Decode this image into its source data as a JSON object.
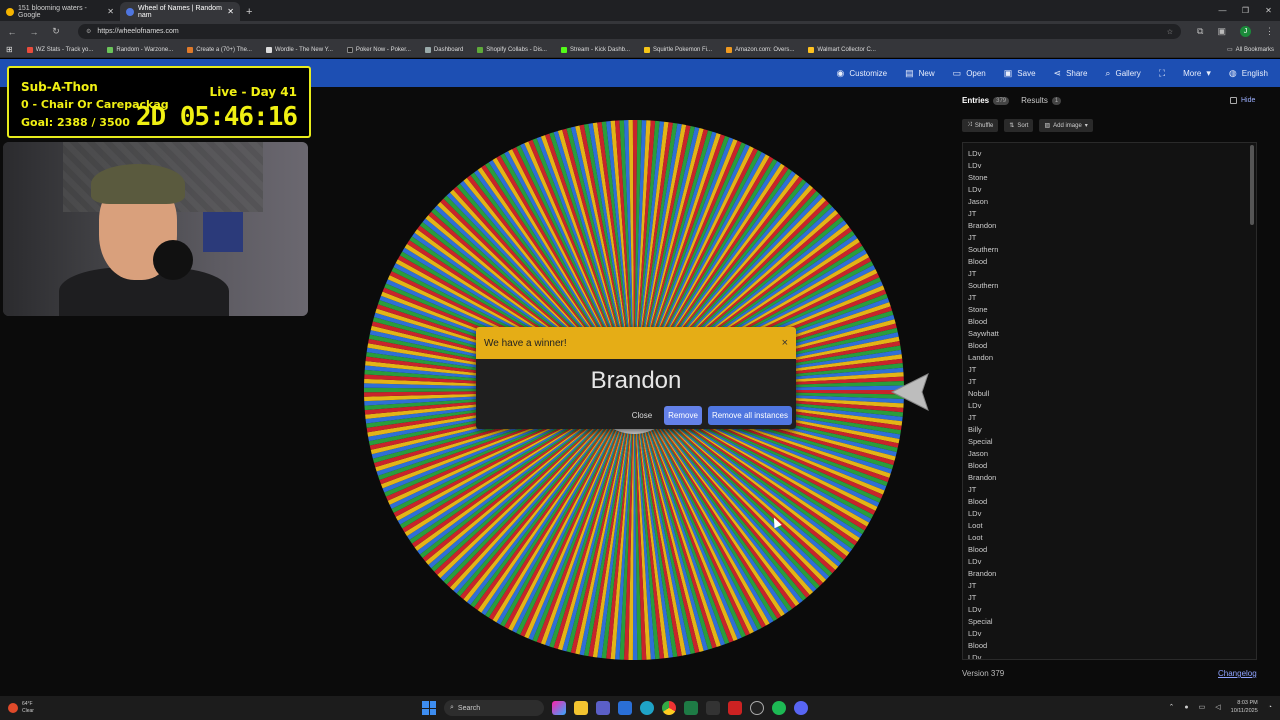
{
  "browser": {
    "tabs": [
      {
        "title": "151 blooming waters - Google",
        "favicon_color": "#f5b400",
        "active": false
      },
      {
        "title": "Wheel of Names | Random nam",
        "favicon_color": "#4f76e0",
        "active": true
      }
    ],
    "new_tab": "+",
    "window_controls": [
      "—",
      "❐",
      "✕"
    ],
    "url": "https://wheelofnames.com",
    "bookmarks": [
      "WZ Stats - Track yo...",
      "Random - Warzone...",
      "Create a (70+) The...",
      "Wordle - The New Y...",
      "Poker Now - Poker...",
      "Dashboard",
      "Shopify Collabs - Dis...",
      "Stream - Kick Dashb...",
      "Squirtle Pokemon Fi...",
      "Amazon.com: Overs...",
      "Walmart Collector C..."
    ],
    "all_bookmarks": "All Bookmarks",
    "profile_initial": "J"
  },
  "appbar": {
    "items": [
      "Customize",
      "New",
      "Open",
      "Save",
      "Share",
      "Gallery",
      "More",
      "English"
    ]
  },
  "overlay": {
    "title": "Sub-A-Thon",
    "subtitle": "0 - Chair Or Carepackag",
    "goal": "Goal: 2388 / 3500",
    "live": "Live - Day 41",
    "timer": "2D 05:46:16"
  },
  "modal": {
    "header": "We have a winner!",
    "close_x": "×",
    "winner": "Brandon",
    "close_btn": "Close",
    "remove_btn": "Remove",
    "remove_all_btn": "Remove all instances"
  },
  "panel": {
    "tab_entries": "Entries",
    "entries_count": "379",
    "tab_results": "Results",
    "results_count": "1",
    "hide": "Hide",
    "shuffle": "Shuffle",
    "sort": "Sort",
    "add_image": "Add image",
    "entries": [
      "LDv",
      "LDv",
      "Stone",
      "LDv",
      "Jason",
      "JT",
      "Brandon",
      "JT",
      "Southern",
      "Blood",
      "JT",
      "Southern",
      "JT",
      "Stone",
      "Blood",
      "Saywhatt",
      "Blood",
      "Landon",
      "JT",
      "JT",
      "Nobull",
      "LDv",
      "JT",
      "Billy",
      "Special",
      "Jason",
      "Blood",
      "Brandon",
      "JT",
      "Blood",
      "LDv",
      "Loot",
      "Loot",
      "Blood",
      "LDv",
      "Brandon",
      "JT",
      "JT",
      "LDv",
      "Special",
      "LDv",
      "Blood",
      "LDv"
    ],
    "version": "Version 379",
    "changelog": "Changelog"
  },
  "wheel": {
    "segment_colors": [
      "#c8242b",
      "#2a9d3c",
      "#2f6fd6",
      "#e3b417"
    ]
  },
  "taskbar": {
    "temp": "64°F",
    "weather": "Clear",
    "search": "Search",
    "time": "8:03 PM",
    "date": "10/11/2025"
  }
}
